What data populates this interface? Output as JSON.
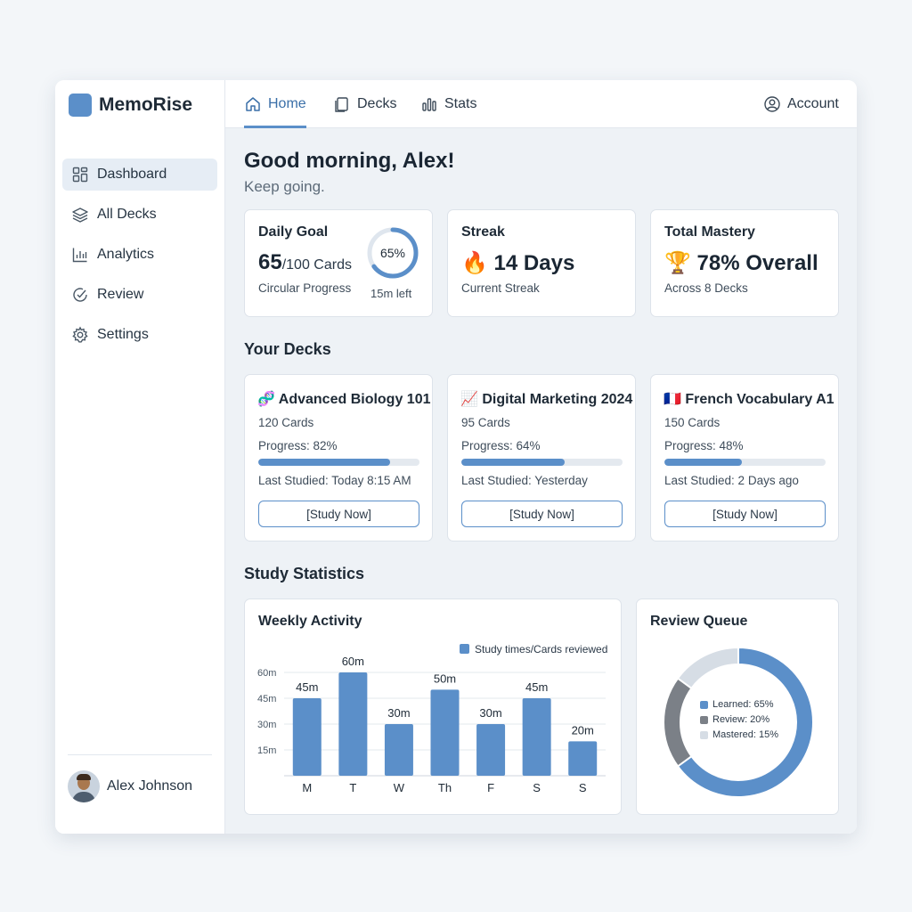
{
  "app": {
    "name": "MemoRise"
  },
  "sidebar": {
    "items": [
      {
        "label": "Dashboard",
        "icon": "dashboard-grid-icon",
        "active": true
      },
      {
        "label": "All Decks",
        "icon": "layers-icon",
        "active": false
      },
      {
        "label": "Analytics",
        "icon": "bar-chart-icon",
        "active": false
      },
      {
        "label": "Review",
        "icon": "check-circle-icon",
        "active": false
      },
      {
        "label": "Settings",
        "icon": "gear-icon",
        "active": false
      }
    ],
    "user": {
      "name": "Alex Johnson"
    }
  },
  "topbar": {
    "tabs": [
      {
        "label": "Home",
        "icon": "home-icon",
        "active": true
      },
      {
        "label": "Decks",
        "icon": "cards-icon",
        "active": false
      },
      {
        "label": "Stats",
        "icon": "stats-icon",
        "active": false
      }
    ],
    "account": {
      "label": "Account",
      "icon": "user-circle-icon"
    }
  },
  "greeting": {
    "title": "Good morning, Alex!",
    "subtitle": "Keep going."
  },
  "summary": {
    "daily_goal": {
      "title": "Daily Goal",
      "value": "65",
      "unit": "/100 Cards",
      "caption": "Circular Progress",
      "ring_label": "65%",
      "ring_progress": 0.65,
      "time_left": "15m left"
    },
    "streak": {
      "title": "Streak",
      "value": "🔥 14 Days",
      "caption": "Current Streak"
    },
    "mastery": {
      "title": "Total Mastery",
      "value": "🏆 78% Overall",
      "caption": "Across 8 Decks"
    }
  },
  "decks": {
    "heading": "Your Decks",
    "items": [
      {
        "title": "🧬 Advanced Biology 101",
        "cards": "120 Cards",
        "progress_label": "Progress: 82%",
        "progress": 0.82,
        "last": "Last Studied: Today 8:15 AM",
        "button": "[Study Now]"
      },
      {
        "title": "📈 Digital Marketing 2024",
        "cards": "95 Cards",
        "progress_label": "Progress: 64%",
        "progress": 0.64,
        "last": "Last Studied: Yesterday",
        "button": "[Study Now]"
      },
      {
        "title": "🇫🇷 French Vocabulary A1",
        "cards": "150 Cards",
        "progress_label": "Progress: 48%",
        "progress": 0.48,
        "last": "Last Studied: 2 Days ago",
        "button": "[Study Now]"
      }
    ]
  },
  "stats": {
    "heading": "Study Statistics",
    "weekly_title": "Weekly Activity",
    "queue_title": "Review Queue"
  },
  "colors": {
    "accent": "#5b8fc9",
    "gray": "#7b8087",
    "light": "#d6dde5"
  },
  "chart_data": [
    {
      "type": "bar",
      "title": "Weekly Activity",
      "categories": [
        "M",
        "T",
        "W",
        "Th",
        "F",
        "S",
        "S"
      ],
      "series": [
        {
          "name": "Study times/Cards reviewed",
          "values": [
            45,
            60,
            30,
            50,
            30,
            45,
            20
          ]
        }
      ],
      "data_labels": [
        "45m",
        "60m",
        "30m",
        "50m",
        "30m",
        "45m",
        "20m"
      ],
      "y_ticks": [
        "15m",
        "30m",
        "45m",
        "60m"
      ],
      "ylim": [
        0,
        60
      ],
      "grid": true,
      "legend": "top-right"
    },
    {
      "type": "pie",
      "title": "Review Queue",
      "slices": [
        {
          "label": "Learned: 65%",
          "value": 65,
          "color": "#5b8fc9"
        },
        {
          "label": "Review: 20%",
          "value": 20,
          "color": "#7b8087"
        },
        {
          "label": "Mastered: 15%",
          "value": 15,
          "color": "#d6dde5"
        }
      ],
      "legend": "center"
    }
  ]
}
